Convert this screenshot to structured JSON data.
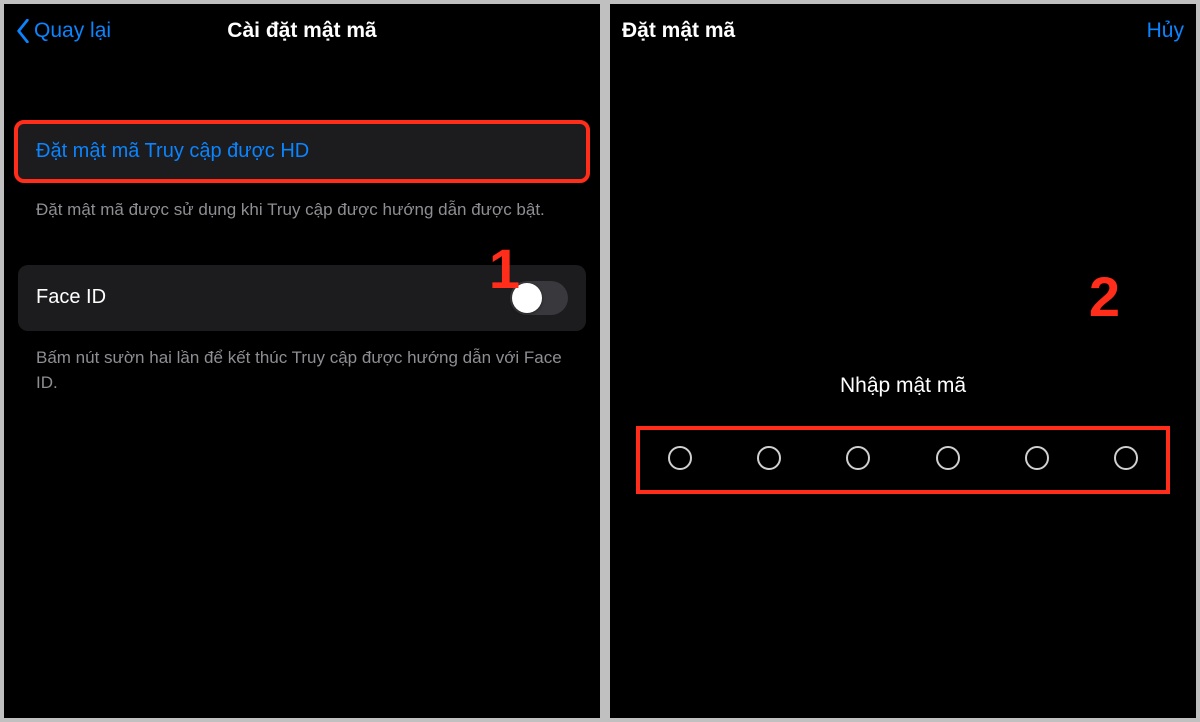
{
  "left": {
    "nav": {
      "back_label": "Quay lại",
      "title": "Cài đặt mật mã"
    },
    "set_passcode": {
      "label": "Đặt mật mã Truy cập được HD",
      "footer": "Đặt mật mã được sử dụng khi Truy cập được hướng dẫn được bật."
    },
    "face_id": {
      "label": "Face ID",
      "on": false,
      "footer": "Bấm nút sườn hai lần để kết thúc Truy cập được hướng dẫn với Face ID."
    },
    "step_number": "1"
  },
  "right": {
    "nav": {
      "title": "Đặt mật mã",
      "cancel_label": "Hủy"
    },
    "passcode": {
      "label": "Nhập mật mã",
      "digits": 6
    },
    "step_number": "2"
  }
}
